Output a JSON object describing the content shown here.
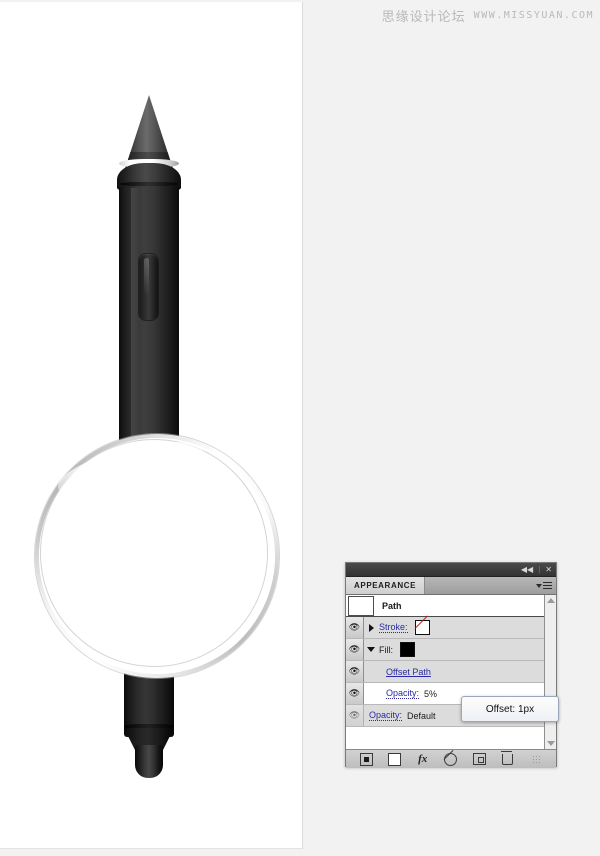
{
  "watermark": {
    "cn": "思缘设计论坛",
    "url": "WWW.MISSYUAN.COM"
  },
  "canvas": {
    "name": "artboard",
    "artwork": "stylus-pen-illustration",
    "magnifier": "magnifying-lens-circle"
  },
  "panel": {
    "titlebar": {
      "collapse": "◀◀",
      "separator": "|",
      "close": "✕"
    },
    "tab_label": "APPEARANCE",
    "menu_icon": "panel-menu-icon",
    "header": {
      "label": "Path"
    },
    "rows": [
      {
        "id": "stroke",
        "eye": "👁",
        "disclosure": "collapsed",
        "label": "Stroke:",
        "value": "",
        "swatch": "none",
        "shaded": true
      },
      {
        "id": "fill",
        "eye": "👁",
        "disclosure": "expanded",
        "label": "Fill:",
        "value": "",
        "swatch": "black",
        "shaded": true
      },
      {
        "id": "offset-path",
        "eye": "👁",
        "disclosure": "none",
        "label": "Offset Path",
        "value": "",
        "swatch": "",
        "shaded": true
      },
      {
        "id": "opacity-fill",
        "eye": "👁",
        "disclosure": "none",
        "label": "Opacity:",
        "value": "5%",
        "swatch": "",
        "shaded": false
      },
      {
        "id": "opacity-object",
        "eye": "👁",
        "disclosure": "none",
        "label": "Opacity:",
        "value": "Default",
        "swatch": "",
        "shaded": true
      }
    ],
    "scrollbar": {
      "up": "scroll-up-arrow",
      "down": "scroll-down-arrow"
    },
    "footer_buttons": [
      {
        "id": "add-new-stroke",
        "icon": "new-stroke-icon"
      },
      {
        "id": "add-new-fill",
        "icon": "new-fill-icon"
      },
      {
        "id": "add-effect",
        "icon": "fx-icon",
        "label": "fx"
      },
      {
        "id": "clear-appearance",
        "icon": "clear-appearance-icon"
      },
      {
        "id": "duplicate-item",
        "icon": "duplicate-icon"
      },
      {
        "id": "delete-item",
        "icon": "trash-icon"
      }
    ]
  },
  "tooltip": {
    "text": "Offset: 1px"
  },
  "colors": {
    "link": "#2a2aa8",
    "panel_bg": "#d6d6d6",
    "row_shaded": "#dcdcdc",
    "row_plain": "#ffffff",
    "swatch_none_slash": "#c01414",
    "watermark": "#b9b9b9"
  }
}
